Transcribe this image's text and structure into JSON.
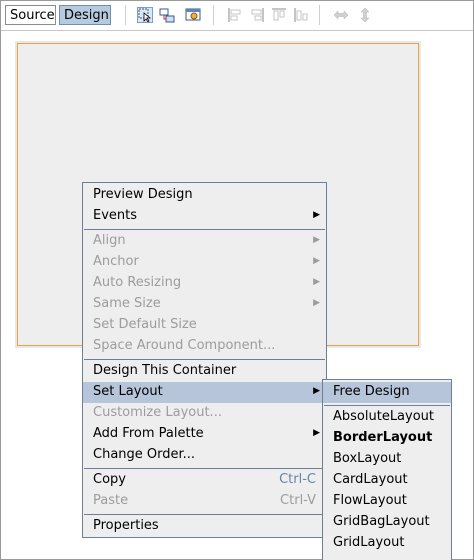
{
  "toolbar": {
    "tabs": [
      "Source",
      "Design"
    ],
    "icons": [
      "selection-mode-icon",
      "connection-mode-icon",
      "preview-design-icon",
      "align-left-icon",
      "align-right-icon",
      "align-top-icon",
      "align-bottom-icon",
      "change-horizontal-resizability-icon",
      "change-vertical-resizability-icon"
    ]
  },
  "menu": {
    "items": [
      {
        "label": "Preview Design"
      },
      {
        "label": "Events"
      },
      {
        "label": "Align"
      },
      {
        "label": "Anchor"
      },
      {
        "label": "Auto Resizing"
      },
      {
        "label": "Same Size"
      },
      {
        "label": "Set Default Size"
      },
      {
        "label": "Space Around Component..."
      },
      {
        "label": "Design This Container"
      },
      {
        "label": "Set Layout"
      },
      {
        "label": "Customize Layout..."
      },
      {
        "label": "Add From Palette"
      },
      {
        "label": "Change Order..."
      },
      {
        "label": "Copy",
        "shortcut": "Ctrl-C"
      },
      {
        "label": "Paste",
        "shortcut": "Ctrl-V"
      },
      {
        "label": "Properties"
      }
    ]
  },
  "submenu": {
    "items": [
      "Free Design",
      "AbsoluteLayout",
      "BorderLayout",
      "BoxLayout",
      "CardLayout",
      "FlowLayout",
      "GridBagLayout",
      "GridLayout"
    ]
  }
}
